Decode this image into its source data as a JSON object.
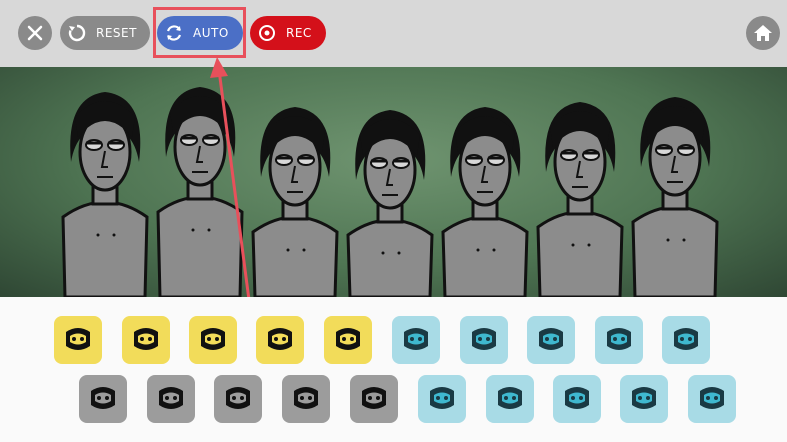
{
  "toolbar": {
    "reset_label": "RESET",
    "auto_label": "AUTO",
    "rec_label": "REC"
  },
  "colors": {
    "toolbar_bg": "#d8d8d8",
    "button_gray": "#8a8a8a",
    "auto_blue": "#4b6fc6",
    "rec_red": "#d4101a",
    "highlight": "#e8505b",
    "stage_green": "#5b8560",
    "tray_bg": "#fafafa",
    "beat_yellow": "#f2dc5a",
    "melody_blue": "#a8dbe6",
    "voice_gray": "#9c9c9c"
  },
  "icons": {
    "row1": [
      "headband-yellow",
      "sun-yellow",
      "star-yellow",
      "hat-stripes-yellow",
      "lion-yellow",
      "headphones-blue",
      "glasses-blue",
      "visor-blue",
      "goggles-blue",
      "top-hat-blue"
    ],
    "row2": [
      "face-gray",
      "beard-gray",
      "gas-mask-gray",
      "splatter-face-gray",
      "horned-mask-gray",
      "cables-blue",
      "wreath-blue",
      "splash-blue",
      "machine-blue",
      "mask-eyes-blue"
    ]
  }
}
